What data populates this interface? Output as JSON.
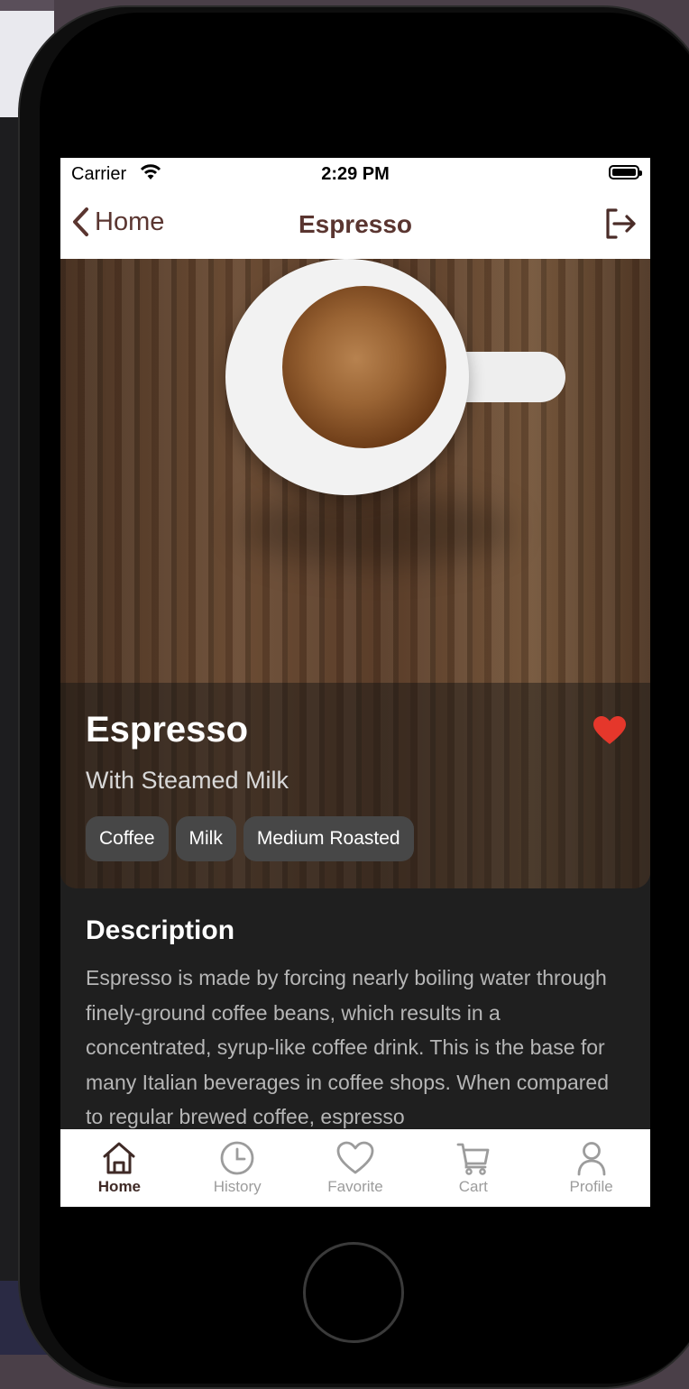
{
  "status_bar": {
    "carrier": "Carrier",
    "time": "2:29 PM"
  },
  "nav": {
    "back_label": "Home",
    "title": "Espresso",
    "logout_icon": "logout-icon"
  },
  "product": {
    "name": "Espresso",
    "subtitle": "With Steamed Milk",
    "tags": [
      "Coffee",
      "Milk",
      "Medium Roasted"
    ],
    "favorite": true,
    "favorite_color": "#e5372b"
  },
  "description": {
    "heading": "Description",
    "text": "Espresso is made by forcing nearly boiling water through finely-ground coffee beans, which results in a concentrated, syrup-like coffee drink. This is the base for many Italian beverages in coffee shops. When compared to regular brewed coffee, espresso"
  },
  "tabbar": {
    "items": [
      {
        "label": "Home",
        "icon": "home-icon",
        "active": true
      },
      {
        "label": "History",
        "icon": "clock-icon",
        "active": false
      },
      {
        "label": "Favorite",
        "icon": "heart-icon",
        "active": false
      },
      {
        "label": "Cart",
        "icon": "cart-icon",
        "active": false
      },
      {
        "label": "Profile",
        "icon": "user-icon",
        "active": false
      }
    ]
  },
  "colors": {
    "accent": "#5a3530",
    "inactive": "#9c9c9c",
    "panel": "#1f1f1f"
  }
}
